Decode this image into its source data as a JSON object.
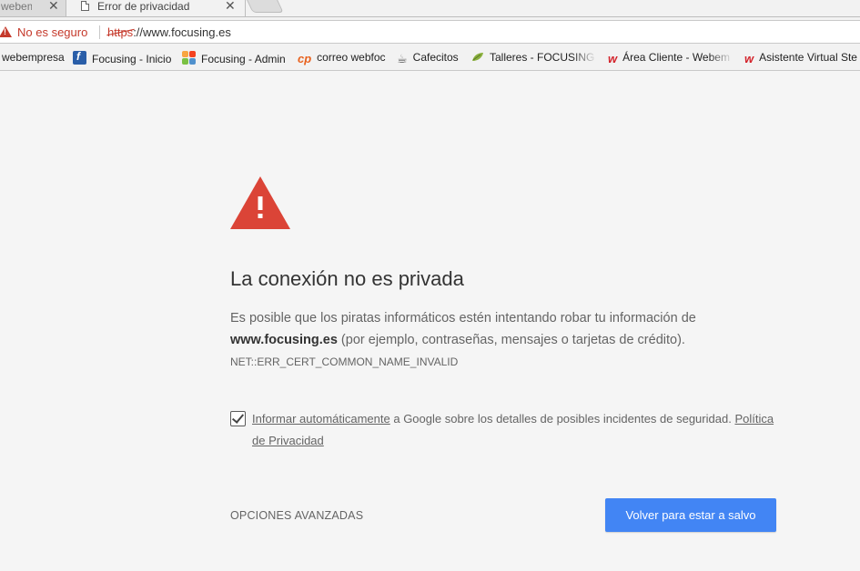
{
  "tabs": [
    {
      "title": "webempresa",
      "active": false
    },
    {
      "title": "Error de privacidad",
      "active": true
    }
  ],
  "omnibox": {
    "security_label": "No es seguro",
    "url_scheme": "https",
    "url_rest": "://www.focusing.es"
  },
  "bookmarks": [
    {
      "label": "webempresa",
      "icon": "none"
    },
    {
      "label": "Focusing - Inicio",
      "icon": "focusing-favicon"
    },
    {
      "label": "Focusing - Admin",
      "icon": "joomla-favicon"
    },
    {
      "label": "correo webfoc",
      "icon": "cpanel-favicon"
    },
    {
      "label": "Cafecitos",
      "icon": "cafe-favicon"
    },
    {
      "label": "Talleres - FOCUSING E",
      "icon": "leaf-favicon"
    },
    {
      "label": "Área Cliente - Webem",
      "icon": "webempresa-favicon"
    },
    {
      "label": "Asistente Virtual Ste",
      "icon": "webempresa-favicon"
    }
  ],
  "interstitial": {
    "headline": "La conexión no es privada",
    "explanation_prefix": "Es posible que los piratas informáticos estén intentando robar tu información de",
    "host": "www.focusing.es",
    "explanation_suffix": " (por ejemplo, contraseñas, mensajes o tarjetas de crédito).",
    "error_code": "NET::ERR_CERT_COMMON_NAME_INVALID",
    "report_checked": true,
    "report_link": "Informar automáticamente",
    "report_text": " a Google sobre los detalles de posibles incidentes de seguridad. ",
    "privacy_link": "Política de Privacidad",
    "advanced_label": "OPCIONES AVANZADAS",
    "primary_button": "Volver para estar a salvo"
  },
  "colors": {
    "danger": "#c5392b",
    "primary": "#4285f4",
    "background": "#f5f5f5"
  }
}
